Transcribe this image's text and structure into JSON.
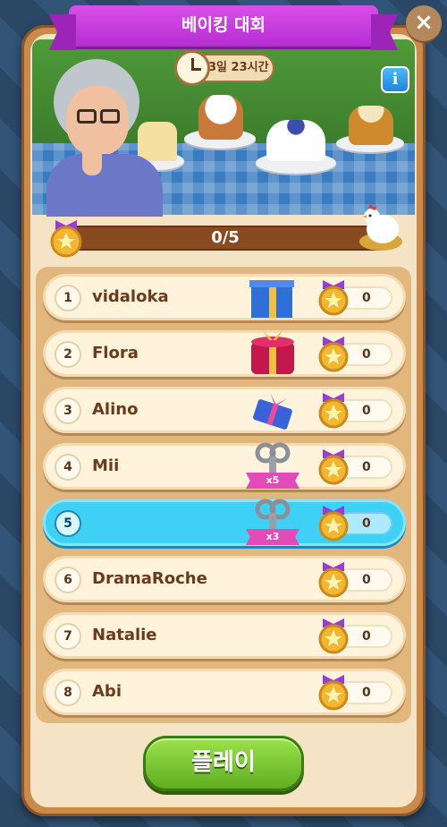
{
  "header": {
    "title": "베이킹 대회",
    "close_label": "×"
  },
  "timer": {
    "text": "3일 23시간"
  },
  "info": {
    "label": "i"
  },
  "progress": {
    "text": "0/5",
    "current": 0,
    "total": 5
  },
  "leaderboard": [
    {
      "rank": "1",
      "name": "vidaloka",
      "score": "0",
      "prize": "blue-gift-box-icon",
      "multiplier": ""
    },
    {
      "rank": "2",
      "name": "Flora",
      "score": "0",
      "prize": "red-gift-box-icon",
      "multiplier": ""
    },
    {
      "rank": "3",
      "name": "Alino",
      "score": "0",
      "prize": "small-blue-gift-icon",
      "multiplier": ""
    },
    {
      "rank": "4",
      "name": "Mii",
      "score": "0",
      "prize": "wind-up-key-icon",
      "multiplier": "x5"
    },
    {
      "rank": "5",
      "name": "",
      "score": "0",
      "prize": "wind-up-key-icon",
      "multiplier": "x3",
      "is_current_user": true
    },
    {
      "rank": "6",
      "name": "DramaRoche",
      "score": "0",
      "prize": "",
      "multiplier": ""
    },
    {
      "rank": "7",
      "name": "Natalie",
      "score": "0",
      "prize": "",
      "multiplier": ""
    },
    {
      "rank": "8",
      "name": "Abi",
      "score": "0",
      "prize": "",
      "multiplier": ""
    }
  ],
  "play_button": {
    "label": "플레이"
  },
  "colors": {
    "ribbon": "#c03bdc",
    "highlight_row": "#3fd0f5",
    "play_green": "#6cc12c",
    "frame": "#c98a4b"
  }
}
